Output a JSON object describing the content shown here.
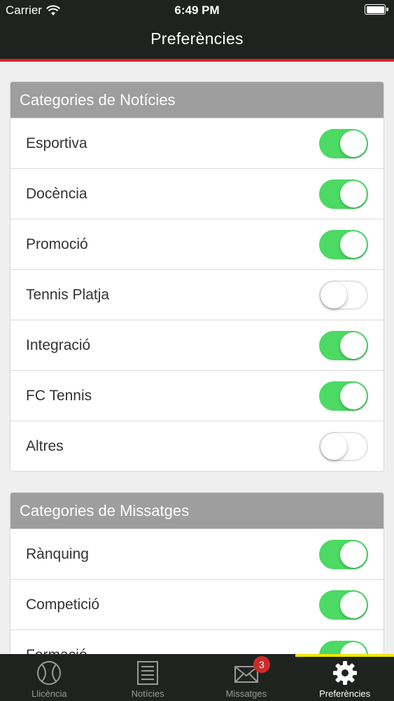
{
  "status_bar": {
    "carrier": "Carrier",
    "time": "6:49 PM"
  },
  "nav": {
    "title": "Preferències"
  },
  "sections": [
    {
      "title": "Categories de Notícies",
      "items": [
        {
          "label": "Esportiva",
          "on": true
        },
        {
          "label": "Docència",
          "on": true
        },
        {
          "label": "Promoció",
          "on": true
        },
        {
          "label": "Tennis Platja",
          "on": false
        },
        {
          "label": "Integració",
          "on": true
        },
        {
          "label": "FC Tennis",
          "on": true
        },
        {
          "label": "Altres",
          "on": false
        }
      ]
    },
    {
      "title": "Categories de Missatges",
      "items": [
        {
          "label": "Rànquing",
          "on": true
        },
        {
          "label": "Competició",
          "on": true
        },
        {
          "label": "Formació",
          "on": true
        }
      ]
    }
  ],
  "tabs": [
    {
      "label": "Llicència",
      "icon": "tennis-ball-icon",
      "active": false
    },
    {
      "label": "Notícies",
      "icon": "newspaper-icon",
      "active": false
    },
    {
      "label": "Missatges",
      "icon": "envelope-icon",
      "active": false,
      "badge": "3"
    },
    {
      "label": "Preferències",
      "icon": "gear-icon",
      "active": true
    }
  ],
  "colors": {
    "bar_background": "#1e2320",
    "accent_red": "#e01f26",
    "toggle_on": "#4cd964",
    "active_tab_indicator": "#f2e600",
    "section_header": "#9e9e9e",
    "badge": "#cc2b2b"
  }
}
